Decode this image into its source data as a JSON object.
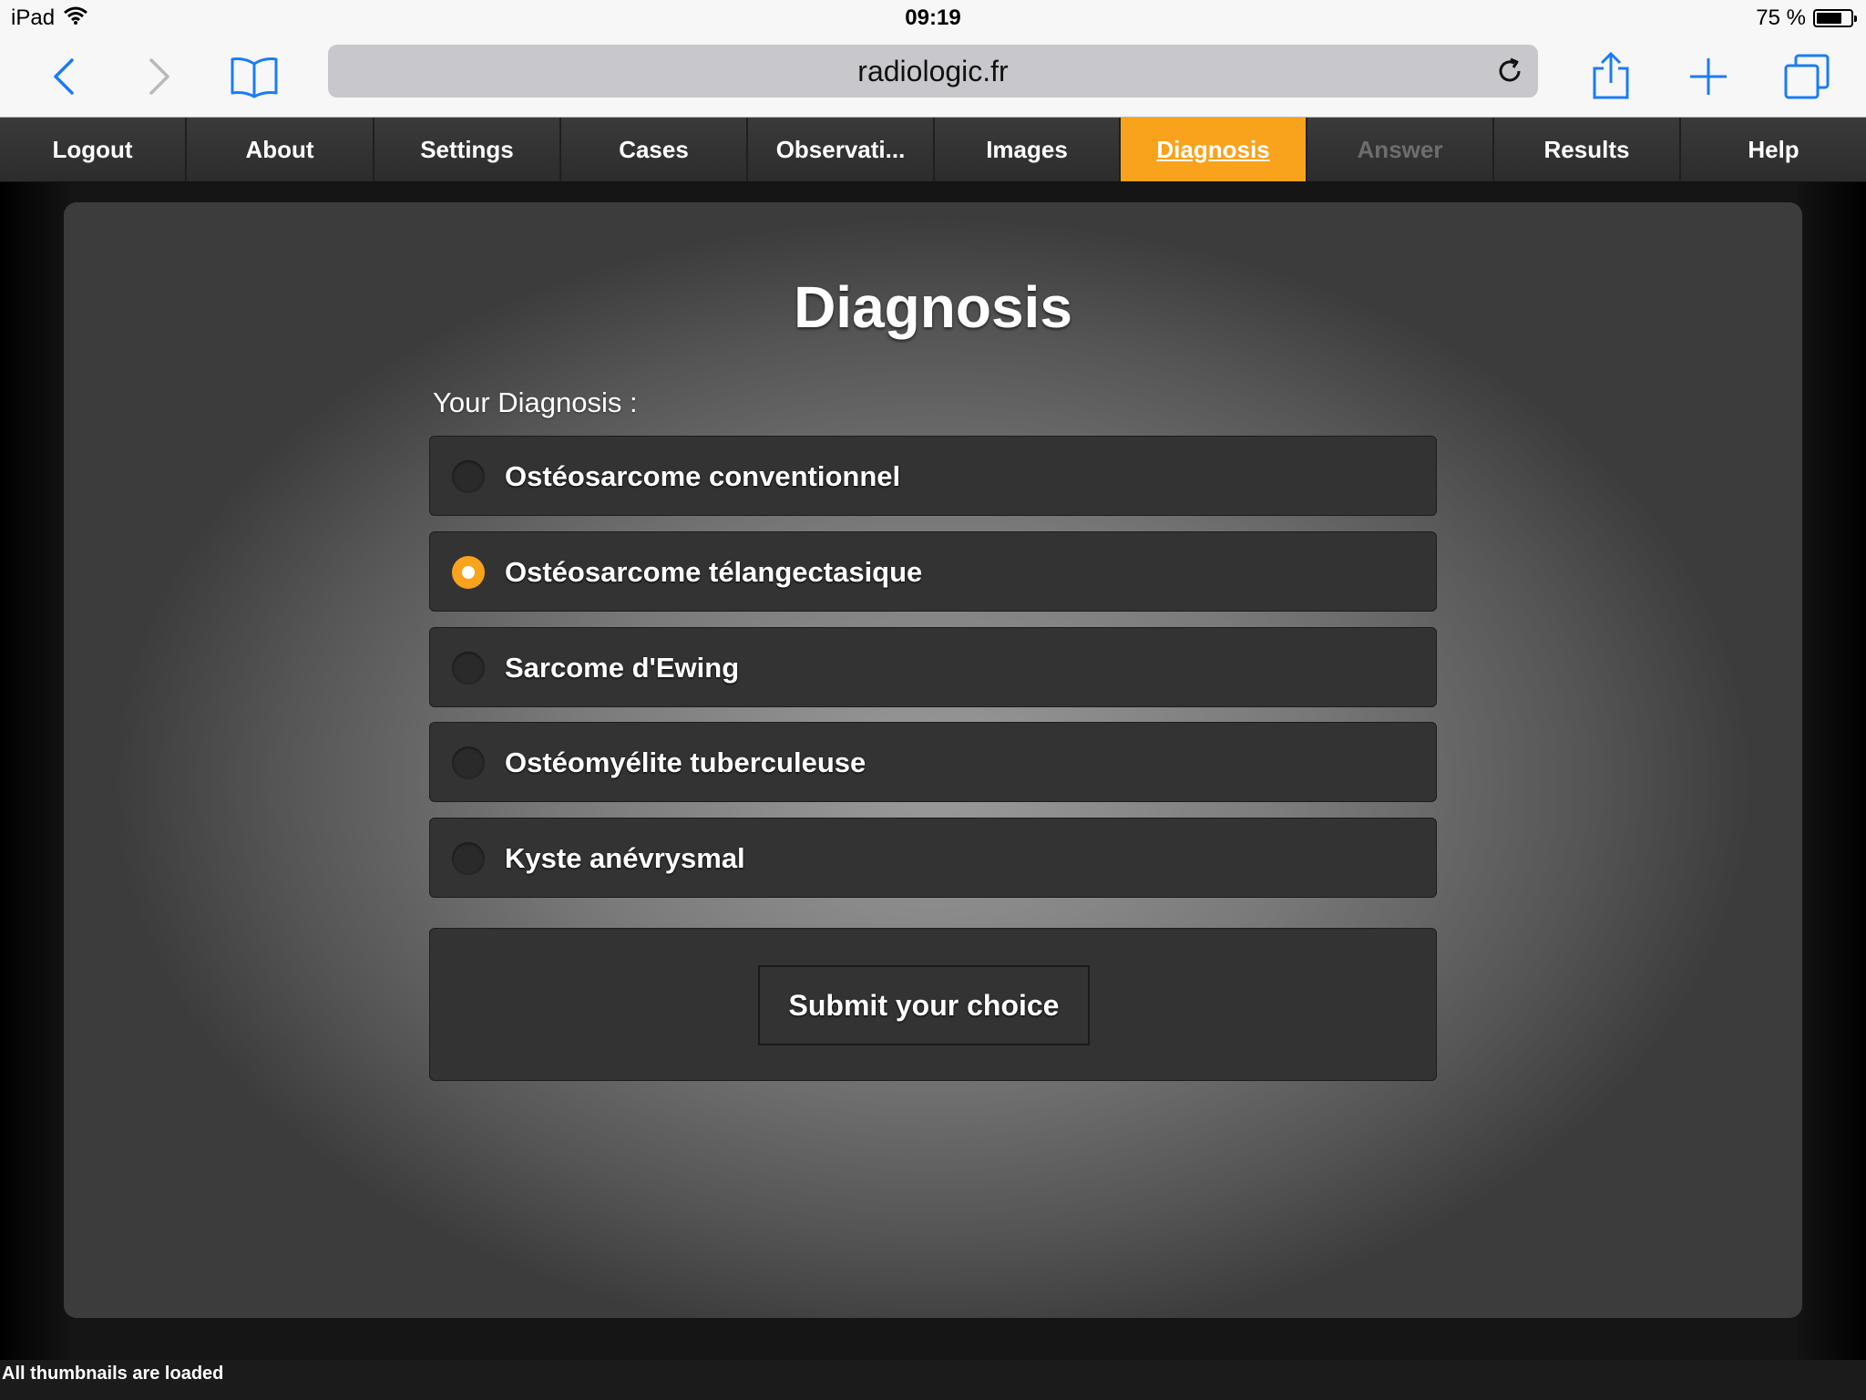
{
  "status_bar": {
    "device": "iPad",
    "time": "09:19",
    "battery": "75 %",
    "battery_level": 0.75
  },
  "browser": {
    "url": "radiologic.fr",
    "icons": [
      "back-icon",
      "forward-icon",
      "bookmarks-icon",
      "reload-icon",
      "share-icon",
      "new-tab-icon",
      "tabs-icon"
    ],
    "accent_color": "#1a7cf5"
  },
  "nav": {
    "tabs": [
      {
        "label": "Logout"
      },
      {
        "label": "About"
      },
      {
        "label": "Settings"
      },
      {
        "label": "Cases"
      },
      {
        "label": "Observati..."
      },
      {
        "label": "Images"
      },
      {
        "label": "Diagnosis"
      },
      {
        "label": "Answer"
      },
      {
        "label": "Results"
      },
      {
        "label": "Help"
      }
    ],
    "active_tab": "Diagnosis",
    "active_color": "#f9a21b"
  },
  "main": {
    "title": "Diagnosis",
    "subtitle": "Your Diagnosis :",
    "options": [
      {
        "label": "Ostéosarcome conventionnel",
        "selected": false
      },
      {
        "label": "Ostéosarcome télangectasique",
        "selected": true
      },
      {
        "label": "Sarcome d'Ewing",
        "selected": false
      },
      {
        "label": "Ostéomyélite tuberculeuse",
        "selected": false
      },
      {
        "label": "Kyste anévrysmal",
        "selected": false
      }
    ],
    "submit_label": "Submit your choice"
  },
  "footer": {
    "text": "All thumbnails are loaded"
  }
}
